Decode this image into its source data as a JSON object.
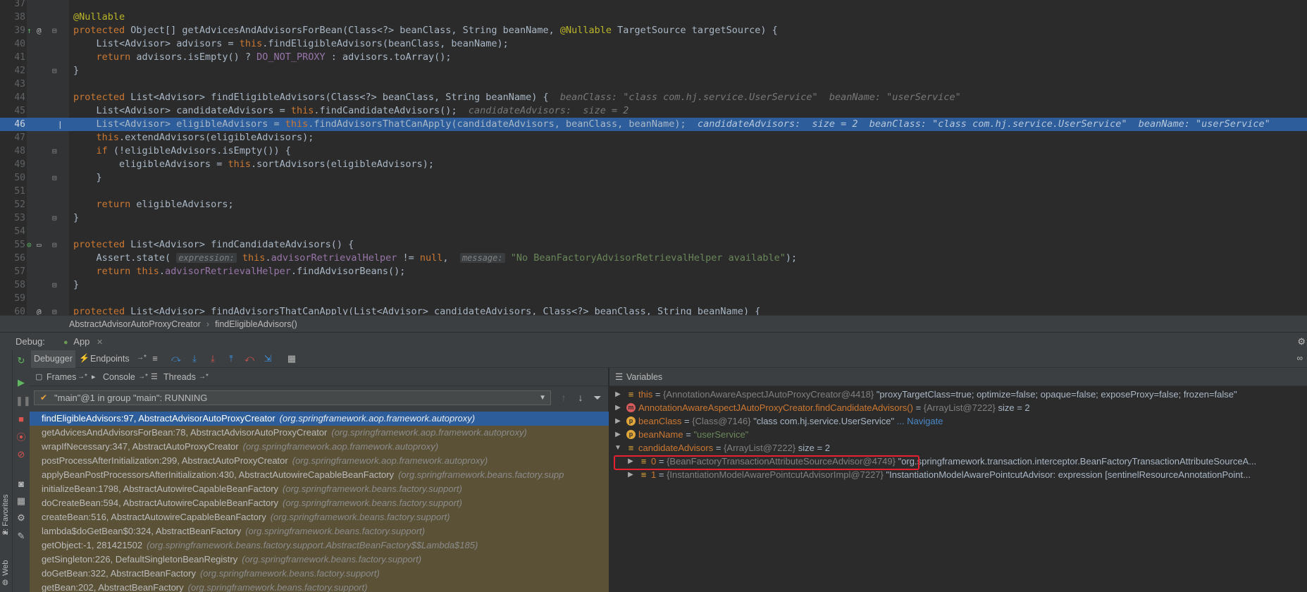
{
  "editor": {
    "lines": [
      {
        "n": "37",
        "tokens": []
      },
      {
        "n": "38",
        "tokens": [
          {
            "c": "ann",
            "t": "@Nullable"
          }
        ]
      },
      {
        "n": "39",
        "tokens": [
          {
            "c": "kw",
            "t": "protected "
          },
          {
            "c": "",
            "t": "Object[] getAdvicesAndAdvisorsForBean(Class<?> beanClass, String beanName, "
          },
          {
            "c": "ann",
            "t": "@Nullable"
          },
          {
            "c": "",
            "t": " TargetSource targetSource) {"
          }
        ]
      },
      {
        "n": "40",
        "tokens": [
          {
            "c": "",
            "t": "    List<Advisor> advisors = "
          },
          {
            "c": "kw",
            "t": "this"
          },
          {
            "c": "",
            "t": ".findEligibleAdvisors(beanClass, beanName);"
          }
        ]
      },
      {
        "n": "41",
        "tokens": [
          {
            "c": "",
            "t": "    "
          },
          {
            "c": "kw",
            "t": "return "
          },
          {
            "c": "",
            "t": "advisors.isEmpty() ? "
          },
          {
            "c": "fld",
            "t": "DO_NOT_PROXY"
          },
          {
            "c": "",
            "t": " : advisors.toArray();"
          }
        ]
      },
      {
        "n": "42",
        "tokens": [
          {
            "c": "",
            "t": "}"
          }
        ]
      },
      {
        "n": "43",
        "tokens": []
      },
      {
        "n": "44",
        "tokens": [
          {
            "c": "kw",
            "t": "protected "
          },
          {
            "c": "",
            "t": "List<Advisor> findEligibleAdvisors(Class<?> beanClass, String beanName) {  "
          },
          {
            "c": "hint",
            "t": "beanClass: \"class com.hj.service.UserService\"  beanName: \"userService\""
          }
        ]
      },
      {
        "n": "45",
        "tokens": [
          {
            "c": "",
            "t": "    List<Advisor> candidateAdvisors = "
          },
          {
            "c": "kw",
            "t": "this"
          },
          {
            "c": "",
            "t": ".findCandidateAdvisors();  "
          },
          {
            "c": "hint",
            "t": "candidateAdvisors:  size = 2"
          }
        ]
      },
      {
        "n": "46",
        "hl": true,
        "tokens": [
          {
            "c": "",
            "t": "    List<Advisor> eligibleAdvisors = "
          },
          {
            "c": "kw",
            "t": "this"
          },
          {
            "c": "",
            "t": ".findAdvisorsThatCanApply(candidateAdvisors, beanClass, beanName);  "
          },
          {
            "c": "hint",
            "t": "candidateAdvisors:  size = 2  beanClass: \"class com.hj.service.UserService\"  beanName: \"userService\""
          }
        ]
      },
      {
        "n": "47",
        "tokens": [
          {
            "c": "",
            "t": "    "
          },
          {
            "c": "kw",
            "t": "this"
          },
          {
            "c": "",
            "t": ".extendAdvisors(eligibleAdvisors);"
          }
        ]
      },
      {
        "n": "48",
        "tokens": [
          {
            "c": "",
            "t": "    "
          },
          {
            "c": "kw",
            "t": "if "
          },
          {
            "c": "",
            "t": "(!eligibleAdvisors.isEmpty()) {"
          }
        ]
      },
      {
        "n": "49",
        "tokens": [
          {
            "c": "",
            "t": "        eligibleAdvisors = "
          },
          {
            "c": "kw",
            "t": "this"
          },
          {
            "c": "",
            "t": ".sortAdvisors(eligibleAdvisors);"
          }
        ]
      },
      {
        "n": "50",
        "tokens": [
          {
            "c": "",
            "t": "    }"
          }
        ]
      },
      {
        "n": "51",
        "tokens": []
      },
      {
        "n": "52",
        "tokens": [
          {
            "c": "",
            "t": "    "
          },
          {
            "c": "kw",
            "t": "return "
          },
          {
            "c": "",
            "t": "eligibleAdvisors;"
          }
        ]
      },
      {
        "n": "53",
        "tokens": [
          {
            "c": "",
            "t": "}"
          }
        ]
      },
      {
        "n": "54",
        "tokens": []
      },
      {
        "n": "55",
        "tokens": [
          {
            "c": "kw",
            "t": "protected "
          },
          {
            "c": "",
            "t": "List<Advisor> findCandidateAdvisors() {"
          }
        ]
      },
      {
        "n": "56",
        "tokens": [
          {
            "c": "",
            "t": "    Assert."
          },
          {
            "c": "",
            "t": "state( "
          },
          {
            "c": "ihint",
            "t": "expression:"
          },
          {
            "c": "kw",
            "t": " this"
          },
          {
            "c": "",
            "t": "."
          },
          {
            "c": "fld",
            "t": "advisorRetrievalHelper"
          },
          {
            "c": "",
            "t": " != "
          },
          {
            "c": "kw",
            "t": "null"
          },
          {
            "c": "",
            "t": ",  "
          },
          {
            "c": "ihint",
            "t": "message:"
          },
          {
            "c": "str",
            "t": " \"No BeanFactoryAdvisorRetrievalHelper available\""
          },
          {
            "c": "",
            "t": ");"
          }
        ]
      },
      {
        "n": "57",
        "tokens": [
          {
            "c": "",
            "t": "    "
          },
          {
            "c": "kw",
            "t": "return this"
          },
          {
            "c": "",
            "t": "."
          },
          {
            "c": "fld",
            "t": "advisorRetrievalHelper"
          },
          {
            "c": "",
            "t": ".findAdvisorBeans();"
          }
        ]
      },
      {
        "n": "58",
        "tokens": [
          {
            "c": "",
            "t": "}"
          }
        ]
      },
      {
        "n": "59",
        "tokens": []
      },
      {
        "n": "60",
        "tokens": [
          {
            "c": "kw",
            "t": "protected "
          },
          {
            "c": "",
            "t": "List<Advisor> findAdvisorsThatCanApply(List<Advisor> candidateAdvisors, Class<?> beanClass, String beanName) {"
          }
        ]
      }
    ]
  },
  "breadcrumb": {
    "class_name": "AbstractAdvisorAutoProxyCreator",
    "method": "findEligibleAdvisors()"
  },
  "debug": {
    "label": "Debug:",
    "app_tab": "App"
  },
  "left_strip": {
    "favorites": "2: Favorites",
    "web": "Web"
  },
  "toolbar": {
    "debugger_tab": "Debugger",
    "endpoints_tab": "Endpoints"
  },
  "frames_panel": {
    "tabs": {
      "frames": "Frames",
      "console": "Console",
      "threads": "Threads"
    },
    "thread": "\"main\"@1 in group \"main\": RUNNING",
    "frames": [
      {
        "method": "findEligibleAdvisors:97, AbstractAdvisorAutoProxyCreator",
        "pkg": "(org.springframework.aop.framework.autoproxy)",
        "sel": true
      },
      {
        "method": "getAdvicesAndAdvisorsForBean:78, AbstractAdvisorAutoProxyCreator",
        "pkg": "(org.springframework.aop.framework.autoproxy)"
      },
      {
        "method": "wrapIfNecessary:347, AbstractAutoProxyCreator",
        "pkg": "(org.springframework.aop.framework.autoproxy)"
      },
      {
        "method": "postProcessAfterInitialization:299, AbstractAutoProxyCreator",
        "pkg": "(org.springframework.aop.framework.autoproxy)"
      },
      {
        "method": "applyBeanPostProcessorsAfterInitialization:430, AbstractAutowireCapableBeanFactory",
        "pkg": "(org.springframework.beans.factory.supp"
      },
      {
        "method": "initializeBean:1798, AbstractAutowireCapableBeanFactory",
        "pkg": "(org.springframework.beans.factory.support)"
      },
      {
        "method": "doCreateBean:594, AbstractAutowireCapableBeanFactory",
        "pkg": "(org.springframework.beans.factory.support)"
      },
      {
        "method": "createBean:516, AbstractAutowireCapableBeanFactory",
        "pkg": "(org.springframework.beans.factory.support)"
      },
      {
        "method": "lambda$doGetBean$0:324, AbstractBeanFactory",
        "pkg": "(org.springframework.beans.factory.support)"
      },
      {
        "method": "getObject:-1, 281421502",
        "pkg": "(org.springframework.beans.factory.support.AbstractBeanFactory$$Lambda$185)"
      },
      {
        "method": "getSingleton:226, DefaultSingletonBeanRegistry",
        "pkg": "(org.springframework.beans.factory.support)"
      },
      {
        "method": "doGetBean:322, AbstractBeanFactory",
        "pkg": "(org.springframework.beans.factory.support)"
      },
      {
        "method": "getBean:202, AbstractBeanFactory",
        "pkg": "(org.springframework.beans.factory.support)"
      }
    ]
  },
  "variables_panel": {
    "title": "Variables",
    "rows": [
      {
        "name": "this",
        "ref": "{AnnotationAwareAspectJAutoProxyCreator@4418}",
        "val": " \"proxyTargetClass=true; optimize=false; opaque=false; exposeProxy=false; frozen=false\"",
        "icon": "lines",
        "indent": 0,
        "arrow": "right"
      },
      {
        "name": "AnnotationAwareAspectJAutoProxyCreator.findCandidateAdvisors()",
        "ref": "{ArrayList@7222}",
        "val": "  size = 2",
        "icon": "method",
        "indent": 0,
        "arrow": "right"
      },
      {
        "name": "beanClass",
        "ref": "{Class@7146}",
        "val": " \"class com.hj.service.UserService\"",
        "nav": "... Navigate",
        "icon": "param",
        "indent": 0,
        "arrow": "right"
      },
      {
        "name": "beanName",
        "ref": "",
        "val": "\"userService\"",
        "icon": "param",
        "indent": 0,
        "arrow": "right"
      },
      {
        "name": "candidateAdvisors",
        "ref": "{ArrayList@7222}",
        "val": "  size = 2",
        "icon": "lines",
        "indent": 0,
        "arrow": "down"
      },
      {
        "name": "0",
        "ref": "{BeanFactoryTransactionAttributeSourceAdvisor@4749}",
        "val": " \"org.springframework.transaction.interceptor.BeanFactoryTransactionAttributeSourceA...",
        "icon": "lines",
        "indent": 1,
        "arrow": "right"
      },
      {
        "name": "1",
        "ref": "{InstantiationModelAwarePointcutAdvisorImpl@7227}",
        "val": " \"InstantiationModelAwarePointcutAdvisor: expression [sentinelResourceAnnotationPoint...",
        "icon": "lines",
        "indent": 1,
        "arrow": "right"
      }
    ]
  },
  "colors": {
    "accent": "#2d5d9a",
    "frame_bg": "#5a5137",
    "highlight_box": "#e8202f"
  }
}
